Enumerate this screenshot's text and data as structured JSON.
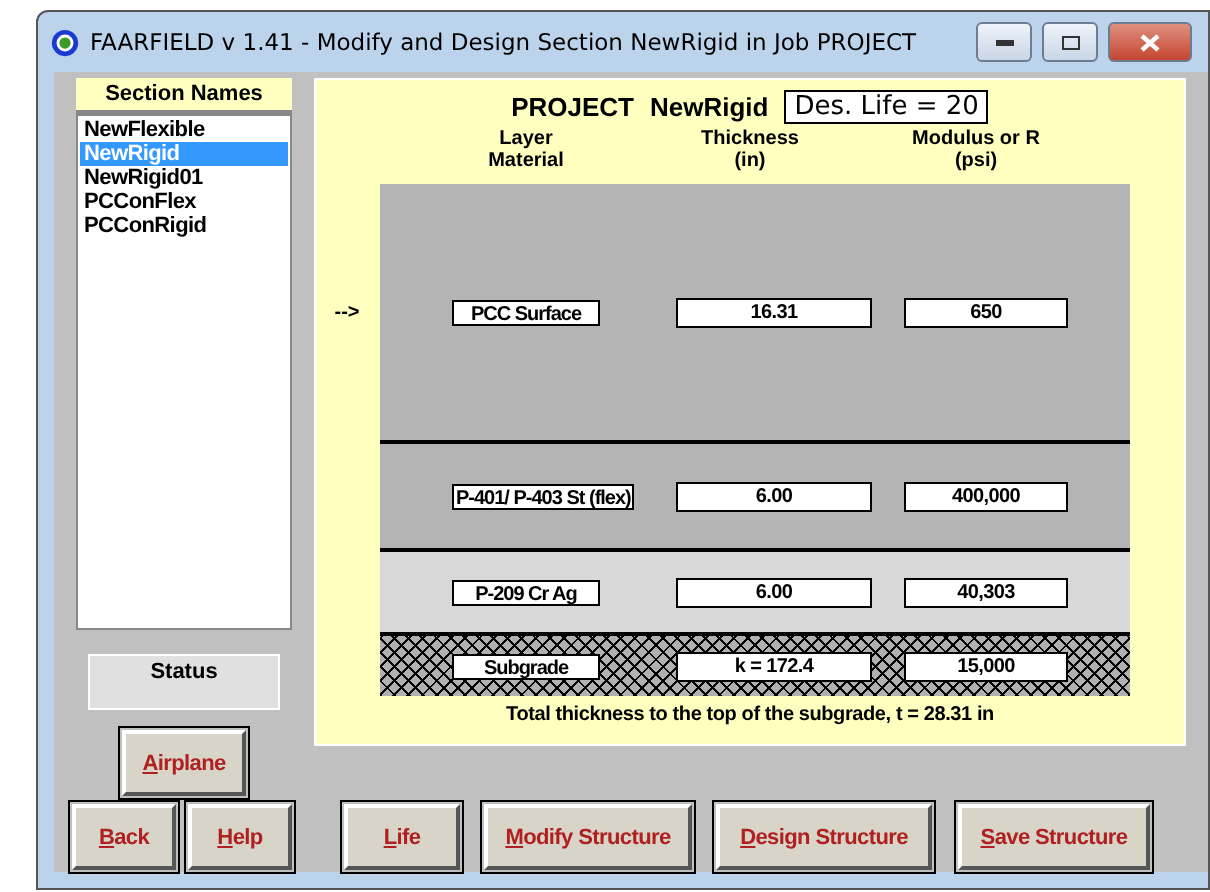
{
  "window": {
    "title": "FAARFIELD v 1.41 - Modify and Design Section NewRigid in Job PROJECT"
  },
  "sections": {
    "header": "Section Names",
    "items": [
      {
        "label": "NewFlexible",
        "selected": false
      },
      {
        "label": "NewRigid",
        "selected": true
      },
      {
        "label": "NewRigid01",
        "selected": false
      },
      {
        "label": "PCConFlex",
        "selected": false
      },
      {
        "label": "PCConRigid",
        "selected": false
      }
    ]
  },
  "status": {
    "label": "Status"
  },
  "structure": {
    "job": "PROJECT",
    "section": "NewRigid",
    "design_life": "Des. Life = 20",
    "columns": [
      "Layer\nMaterial",
      "Thickness\n(in)",
      "Modulus or R\n(psi)"
    ],
    "layers": [
      {
        "kind": "surface",
        "marker": "-->",
        "material": "PCC Surface",
        "thickness": "16.31",
        "modulus": "650"
      },
      {
        "kind": "base",
        "material": "P-401/ P-403 St (flex)",
        "thickness": "6.00",
        "modulus": "400,000"
      },
      {
        "kind": "subbase",
        "material": "P-209 Cr Ag",
        "thickness": "6.00",
        "modulus": "40,303"
      },
      {
        "kind": "subgrade",
        "material": "Subgrade",
        "thickness": "k = 172.4",
        "modulus": "15,000"
      }
    ],
    "total": "Total thickness to the top of the subgrade, t = 28.31 in"
  },
  "buttons": {
    "airplane": "Airplane",
    "bottom": [
      "Back",
      "Help",
      "Life",
      "Modify Structure",
      "Design Structure",
      "Save Structure"
    ]
  }
}
